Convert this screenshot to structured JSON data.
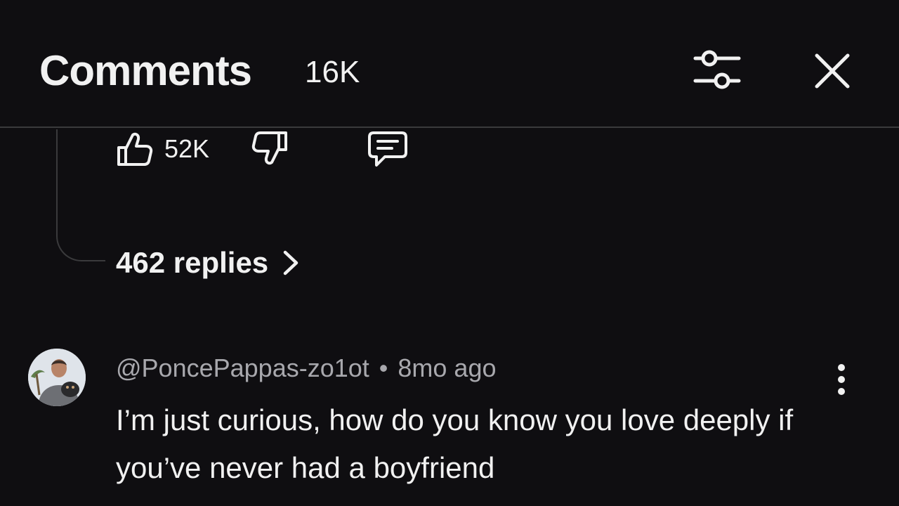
{
  "header": {
    "title": "Comments",
    "count": "16K",
    "filter_icon": "sliders-icon",
    "close_icon": "close-icon"
  },
  "parent_comment": {
    "like_count": "52K",
    "like_icon": "thumbs-up-icon",
    "dislike_icon": "thumbs-down-icon",
    "reply_icon": "comment-icon",
    "replies_label": "462 replies",
    "replies_chevron_icon": "chevron-right-icon"
  },
  "comment": {
    "author": "@PoncePappas-zo1ot",
    "separator": "•",
    "time": "8mo ago",
    "text": "I’m just curious, how do you know you love deeply if you’ve never had a boyfriend",
    "more_icon": "more-vertical-icon"
  },
  "colors": {
    "background": "#0f0e11",
    "text": "#f1f1f1",
    "secondary_text": "#a8a8ad",
    "divider": "#3a3a3c"
  }
}
